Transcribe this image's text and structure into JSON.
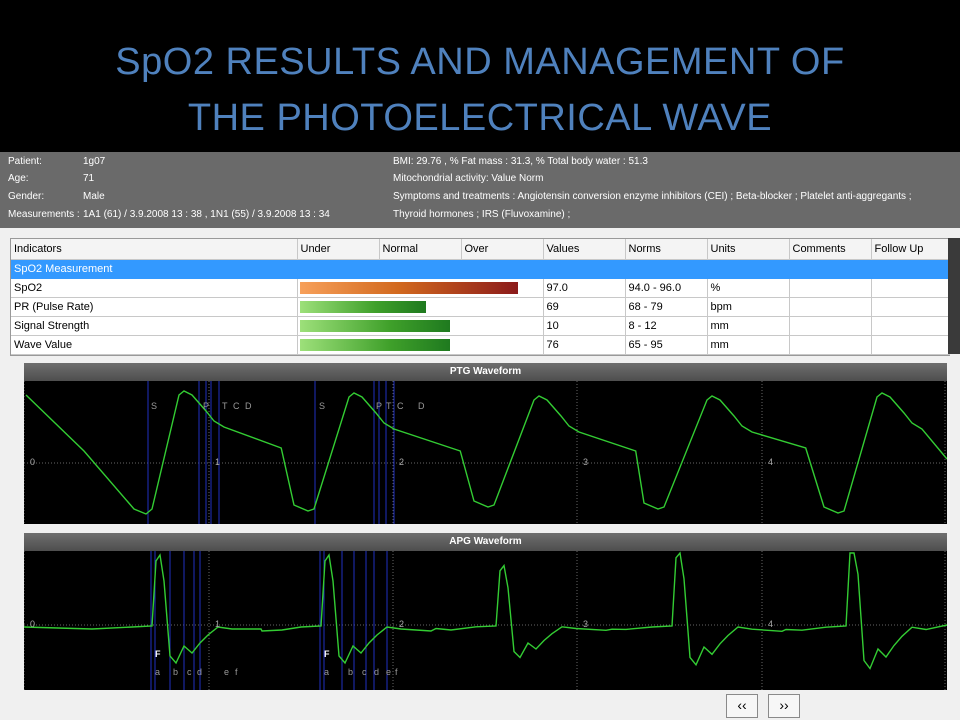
{
  "slide": {
    "title_line1": "SpO2 RESULTS AND MANAGEMENT OF",
    "title_line2": "THE PHOTOELECTRICAL WAVE"
  },
  "patient": {
    "patient_label": "Patient:",
    "patient_value": "1g07",
    "age_label": "Age:",
    "age_value": "71",
    "gender_label": "Gender:",
    "gender_value": "Male",
    "measurements_label": "Measurements :",
    "measurements_value": "1A1  (61)  / 3.9.2008  13 : 38 , 1N1  (55)  / 3.9.2008  13 : 34",
    "bmi": "BMI:   29.76  ,  % Fat mass : 31.3,  % Total body water  : 51.3",
    "mitochondrial": "Mitochondrial activity: Value Norm",
    "symptoms": "Symptoms and treatments : Angiotensin conversion enzyme inhibitors (CEI) ; Beta-blocker ; Platelet anti-aggregants ;",
    "thyroid": "Thyroid hormones ; IRS (Fluvoxamine) ;"
  },
  "table": {
    "headers": [
      "Indicators",
      "Under",
      "Normal",
      "Over",
      "Values",
      "Norms",
      "Units",
      "Comments",
      "Follow Up"
    ],
    "group": "SpO2 Measurement",
    "rows": [
      {
        "indicator": "SpO2",
        "value": "97.0",
        "norm": "94.0 - 96.0",
        "unit": "%",
        "bar_level": 0.9,
        "bar_color": "orange"
      },
      {
        "indicator": "PR (Pulse Rate)",
        "value": "69",
        "norm": "68 - 79",
        "unit": "bpm",
        "bar_level": 0.52,
        "bar_color": "green"
      },
      {
        "indicator": "Signal Strength",
        "value": "10",
        "norm": "8 - 12",
        "unit": "mm",
        "bar_level": 0.62,
        "bar_color": "green"
      },
      {
        "indicator": "Wave Value",
        "value": "76",
        "norm": "65 - 95",
        "unit": "mm",
        "bar_level": 0.62,
        "bar_color": "green"
      }
    ]
  },
  "ptg": {
    "title": "PTG Waveform",
    "ticks": [
      "0",
      "1",
      "2",
      "3",
      "4"
    ],
    "markers1": [
      "S",
      "P",
      "T",
      "C",
      "D"
    ],
    "markers2": [
      "S",
      "P",
      "T",
      "C",
      "D"
    ]
  },
  "apg": {
    "title": "APG Waveform",
    "ticks": [
      "0",
      "1",
      "2",
      "3",
      "4"
    ],
    "f1": "F",
    "f2": "F",
    "letters1": [
      "a",
      "b",
      "c",
      "d",
      "e",
      "f"
    ],
    "letters2": [
      "a",
      "b",
      "c",
      "d",
      "e",
      "f"
    ]
  },
  "nav": {
    "prev": "‹‹",
    "next": "››"
  },
  "colors": {
    "title": "#4f81bd",
    "wave": "#33cc33",
    "selection": "#3399ff"
  }
}
